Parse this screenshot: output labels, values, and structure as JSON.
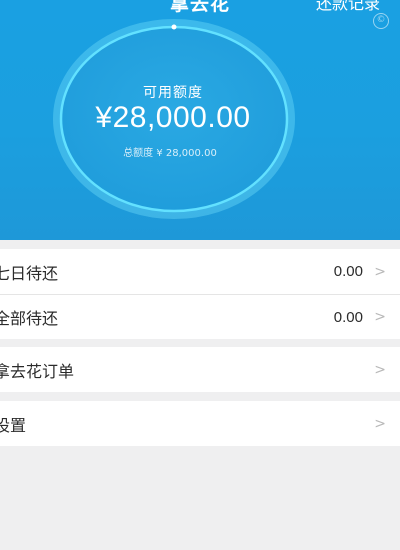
{
  "header": {
    "title": "拿去花",
    "repay_record_link": "还款记录",
    "corner_icon": "copyright-icon"
  },
  "credit": {
    "available_label": "可用额度",
    "available_amount": "¥28,000.00",
    "total_label": "总额度 ¥ 28,000.00"
  },
  "repay_group": [
    {
      "label": "七日待还",
      "value": "0.00"
    },
    {
      "label": "全部待还",
      "value": "0.00"
    }
  ],
  "menu_group": [
    {
      "label": "拿去花订单"
    }
  ],
  "settings_group": [
    {
      "label": "设置"
    }
  ],
  "chevron_glyph": ">",
  "colors": {
    "header_bg": "#1aa0e2",
    "ring": "#5fe0ff",
    "page_bg": "#efeff0"
  }
}
